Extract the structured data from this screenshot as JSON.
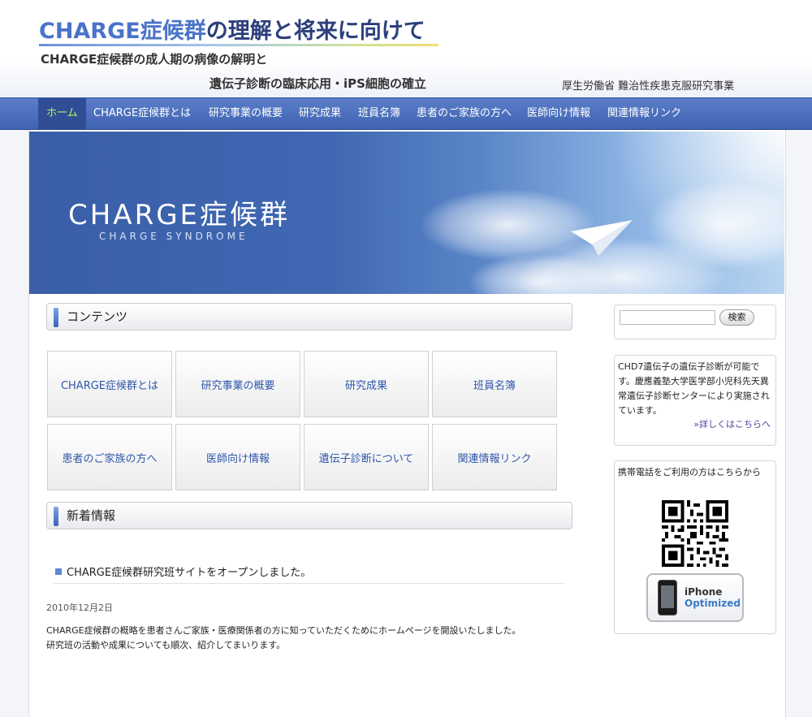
{
  "header": {
    "title_highlight": "CHARGE症候群",
    "title_rest": "の理解と将来に向けて",
    "subtitle_line1": "CHARGE症候群の成人期の病像の解明と",
    "subtitle_line2": "遺伝子診断の臨床応用・iPS細胞の確立",
    "ministry": "厚生労働省 難治性疾患克服研究事業"
  },
  "nav": {
    "items": [
      {
        "label": "ホーム",
        "active": true
      },
      {
        "label": "CHARGE症候群とは"
      },
      {
        "label": "研究事業の概要"
      },
      {
        "label": "研究成果"
      },
      {
        "label": "班員名簿"
      },
      {
        "label": "患者のご家族の方へ"
      },
      {
        "label": "医師向け情報"
      },
      {
        "label": "関連情報リンク"
      }
    ]
  },
  "banner": {
    "title": "CHARGE症候群",
    "subtitle": "CHARGE SYNDROME"
  },
  "contents": {
    "heading": "コンテンツ",
    "tiles": [
      "CHARGE症候群とは",
      "研究事業の概要",
      "研究成果",
      "班員名簿",
      "患者のご家族の方へ",
      "医師向け情報",
      "遺伝子診断について",
      "関連情報リンク"
    ]
  },
  "news": {
    "heading": "新着情報",
    "item_title": "CHARGE症候群研究班サイトをオープンしました。",
    "date": "2010年12月2日",
    "body_line1": "CHARGE症候群の概略を患者さんご家族・医療関係者の方に知っていただくためにホームページを開設いたしました。",
    "body_line2": "研究班の活動や成果についても順次、紹介してまいります。"
  },
  "sidebar": {
    "search": {
      "value": "",
      "button_label": "検索"
    },
    "diagnosis": {
      "text": "CHD7遺伝子の遺伝子診断が可能です。慶應義塾大学医学部小児科先天異常遺伝子診断センターにより実施されています。",
      "link": "»詳しくはこちらへ"
    },
    "mobile": {
      "text": "携帯電話をご利用の方はこちらから",
      "badge_line1": "iPhone",
      "badge_line2": "Optimized"
    }
  },
  "colors": {
    "nav_bg": "#4a6fbf",
    "nav_active_text": "#b8f070",
    "link_blue": "#2f56a8",
    "title_dark": "#2c3f7c"
  }
}
